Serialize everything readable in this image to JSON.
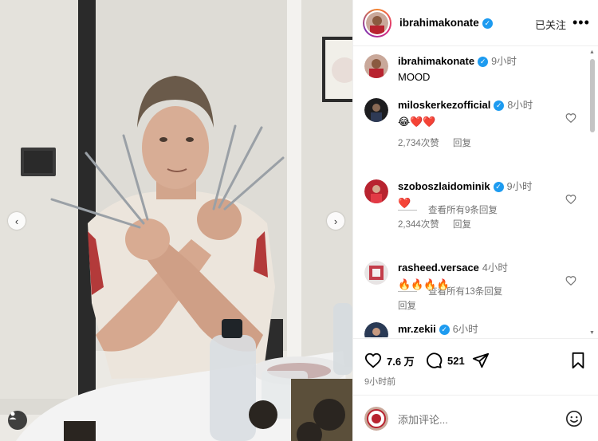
{
  "post": {
    "nav_prev": "‹",
    "nav_next": "›"
  },
  "header": {
    "username": "ibrahimakonate",
    "verified_mark": "✓",
    "follow_state": "已关注",
    "more_label": "•••"
  },
  "caption": {
    "username": "ibrahimakonate",
    "time": "9小时",
    "text": "MOOD"
  },
  "comments": [
    {
      "username": "miloskerkezofficial",
      "time": "8小时",
      "text": "😂❤️❤️",
      "likes": "2,734次赞",
      "reply_label": "回复",
      "view_replies": "查看所有9条回复"
    },
    {
      "username": "szoboszlaidominik",
      "time": "9小时",
      "text": "❤️",
      "likes": "2,344次赞",
      "reply_label": "回复",
      "view_replies": "查看所有13条回复"
    },
    {
      "username": "rasheed.versace",
      "time": "4小时",
      "text": "🔥🔥🔥🔥",
      "reply_label": "回复"
    },
    {
      "username": "mr.zekii",
      "time": "6小时",
      "text": "🔥🔥🔥🔥"
    }
  ],
  "actions": {
    "likes": "7.6 万",
    "comments": "521",
    "posted_ago": "9小时前"
  },
  "composer": {
    "placeholder": "添加评论..."
  },
  "icons": {
    "like": "heart-icon",
    "comment": "comment-icon",
    "share": "send-icon",
    "save": "bookmark-icon",
    "emoji": "emoji-icon",
    "tag": "person-tag-icon",
    "more": "more-icon"
  },
  "colors": {
    "verified": "#1d9bf0",
    "secondary_text": "#737373",
    "heart_red": "#ed4956"
  }
}
